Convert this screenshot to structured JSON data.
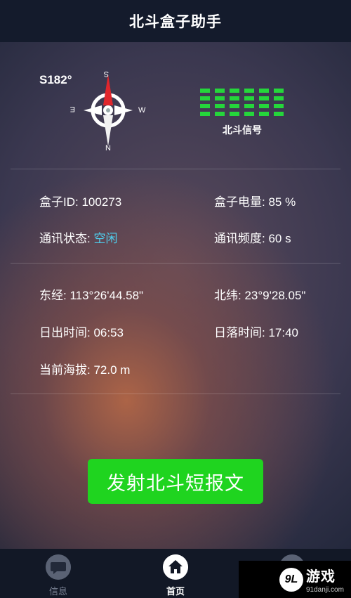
{
  "header": {
    "title": "北斗盒子助手"
  },
  "compass": {
    "heading": "S182°",
    "directions": {
      "s": "S",
      "w": "W",
      "e": "E",
      "n": "N"
    }
  },
  "signal": {
    "label": "北斗信号",
    "color": "#25d63b"
  },
  "status": {
    "box_id_label": "盒子ID: ",
    "box_id": "100273",
    "battery_label": "盒子电量: ",
    "battery": "85 %",
    "comm_state_label": "通讯状态: ",
    "comm_state": "空闲",
    "comm_freq_label": "通讯频度: ",
    "comm_freq": "60 s"
  },
  "location": {
    "longitude_label": "东经: ",
    "longitude": "113°26'44.58\"",
    "latitude_label": "北纬: ",
    "latitude": "23°9'28.05\"",
    "sunrise_label": "日出时间: ",
    "sunrise": "06:53",
    "sunset_label": "日落时间: ",
    "sunset": "17:40",
    "altitude_label": "当前海拔: ",
    "altitude": "72.0 m"
  },
  "actions": {
    "send_button": "发射北斗短报文",
    "button_color": "#1fd41f"
  },
  "bottom_nav": [
    {
      "label": "信息",
      "icon": "message-icon"
    },
    {
      "label": "首页",
      "icon": "home-icon",
      "active": true
    },
    {
      "label": "",
      "icon": "settings-icon"
    }
  ],
  "watermark": {
    "logo": "9L",
    "name": "游戏",
    "domain": "91danji.com"
  }
}
